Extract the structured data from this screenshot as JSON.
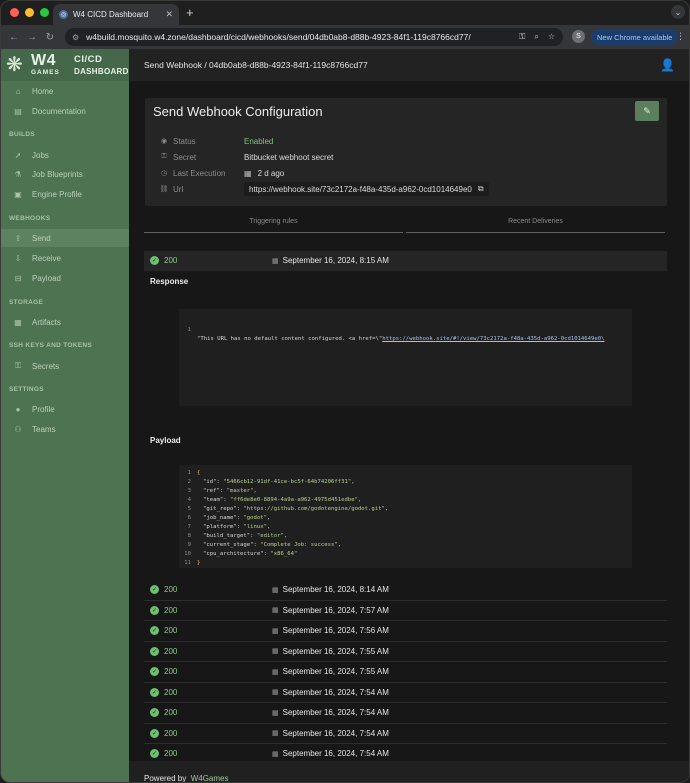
{
  "browser": {
    "tab_title": "W4 CICD Dashboard",
    "url": "w4build.mosquito.w4.zone/dashboard/cicd/webhooks/send/04db0ab8-d88b-4923-84f1-119c8766cd77/",
    "new_chrome": "New Chrome available",
    "profile_initial": "S"
  },
  "logo": {
    "w4": "W4",
    "games": "GAMES",
    "cicd": "CI/CD",
    "dashboard": "DASHBOARD"
  },
  "sidebar": {
    "top": [
      {
        "label": "Home",
        "icon": "home-icon"
      },
      {
        "label": "Documentation",
        "icon": "book-icon"
      }
    ],
    "sections": [
      {
        "title": "BUILDS",
        "items": [
          "Jobs",
          "Job Blueprints",
          "Engine Profile"
        ]
      },
      {
        "title": "WEBHOOKS",
        "items": [
          "Send",
          "Receive",
          "Payload"
        ]
      },
      {
        "title": "STORAGE",
        "items": [
          "Artifacts"
        ]
      },
      {
        "title": "SSH KEYS AND TOKENS",
        "items": [
          "Secrets"
        ]
      },
      {
        "title": "SETTINGS",
        "items": [
          "Profile",
          "Teams"
        ]
      }
    ],
    "active": "Send"
  },
  "topbar": {
    "breadcrumb": "Send Webhook / 04db0ab8-d88b-4923-84f1-119c8766cd77"
  },
  "config": {
    "title": "Send Webhook Configuration",
    "fields": [
      {
        "label": "Status",
        "value": "Enabled"
      },
      {
        "label": "Secret",
        "value": "Bitbucket webhoot secret"
      },
      {
        "label": "Last Execution",
        "value": "2 d ago"
      },
      {
        "label": "Url",
        "value": "https://webhook.site/73c2172a-f48a-435d-a962-0cd1014649e0"
      }
    ]
  },
  "tabs": [
    "Triggering rules",
    "Recent Deliveries"
  ],
  "expanded": {
    "code": "200",
    "date": "September 16, 2024, 8:15 AM",
    "response_label": "Response",
    "response_line": {
      "num": "1",
      "text": "\"This URL has no default content configured. <a href=\\\"",
      "link": "https://webhook.site/#!/view/73c2172a-f48a-435d-a962-0cd1014649e0\\"
    },
    "payload_label": "Payload",
    "payload_lines": [
      {
        "num": "1",
        "text": "{"
      },
      {
        "num": "2",
        "key": "\"id\"",
        "val": "\"5466cb12-91df-41ce-bc5f-64b74206ff31\""
      },
      {
        "num": "3",
        "key": "\"ref\"",
        "val": "\"master\""
      },
      {
        "num": "4",
        "key": "\"team\"",
        "val": "\"ff6de8e0-8894-4a9a-a962-4975d451edbe\""
      },
      {
        "num": "5",
        "key": "\"git_repo\"",
        "val": "\"https://github.com/godotengine/godot.git\""
      },
      {
        "num": "6",
        "key": "\"job_name\"",
        "val": "\"godot\""
      },
      {
        "num": "7",
        "key": "\"platform\"",
        "val": "\"linux\""
      },
      {
        "num": "8",
        "key": "\"build_target\"",
        "val": "\"editor\""
      },
      {
        "num": "9",
        "key": "\"current_stage\"",
        "val": "\"Complete Job: success\""
      },
      {
        "num": "10",
        "key": "\"cpu_architecture\"",
        "val": "\"x86_64\""
      },
      {
        "num": "11",
        "text": "}"
      }
    ]
  },
  "deliveries": [
    {
      "code": "200",
      "date": "September 16, 2024, 8:14 AM"
    },
    {
      "code": "200",
      "date": "September 16, 2024, 7:57 AM"
    },
    {
      "code": "200",
      "date": "September 16, 2024, 7:56 AM"
    },
    {
      "code": "200",
      "date": "September 16, 2024, 7:55 AM"
    },
    {
      "code": "200",
      "date": "September 16, 2024, 7:55 AM"
    },
    {
      "code": "200",
      "date": "September 16, 2024, 7:54 AM"
    },
    {
      "code": "200",
      "date": "September 16, 2024, 7:54 AM"
    },
    {
      "code": "200",
      "date": "September 16, 2024, 7:54 AM"
    },
    {
      "code": "200",
      "date": "September 16, 2024, 7:54 AM"
    }
  ],
  "footer": {
    "prefix": "Powered by",
    "link": "W4Games"
  }
}
